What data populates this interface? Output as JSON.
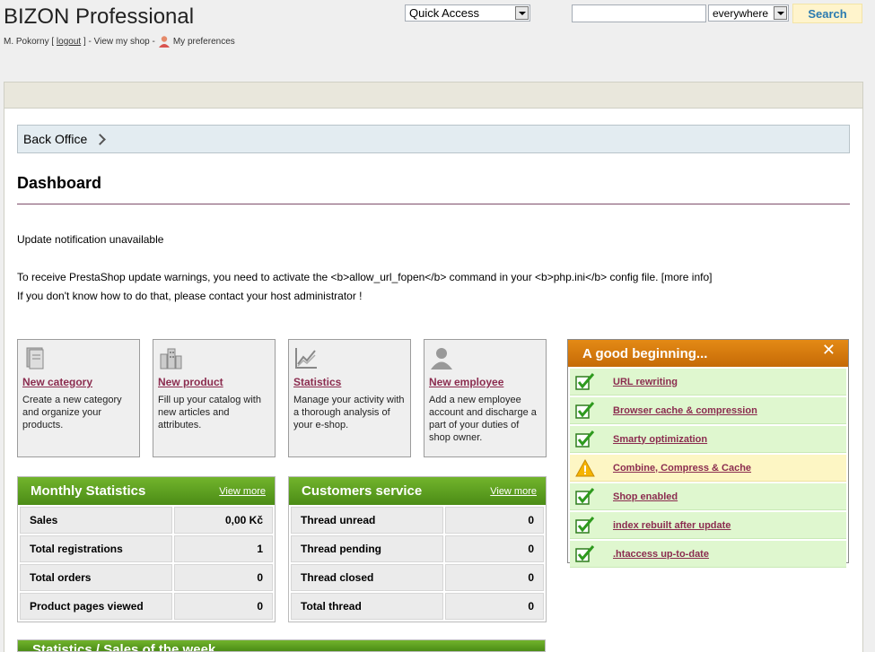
{
  "header": {
    "brand": "BIZON Professional",
    "user_name": "M. Pokorny",
    "logout_open": "[",
    "logout_label": "logout",
    "logout_close": "]",
    "sep1": "-",
    "view_shop_label": "View my shop",
    "sep2": "-",
    "preferences_label": "My preferences",
    "quick_access_value": "Quick Access",
    "search_value": "",
    "search_scope_value": "everywhere",
    "search_button_label": "Search"
  },
  "breadcrumb": {
    "label": "Back Office"
  },
  "page": {
    "title": "Dashboard",
    "update_notice": "Update notification unavailable",
    "warning_line1": "To receive PrestaShop update warnings, you need to activate the <b>allow_url_fopen</b> command in your <b>php.ini</b> config file. [more info]",
    "warning_line2": "If you don't know how to do that, please contact your host administrator !"
  },
  "quick_tiles": [
    {
      "title": "New category",
      "desc": "Create a new category and organize your products.",
      "icon": "catalog-icon"
    },
    {
      "title": "New product",
      "desc": "Fill up your catalog with new articles and attributes.",
      "icon": "product-icon"
    },
    {
      "title": "Statistics",
      "desc": "Manage your activity with a thorough analysis of your e-shop.",
      "icon": "chart-icon"
    },
    {
      "title": "New employee",
      "desc": "Add a new employee account and discharge a part of your duties of shop owner.",
      "icon": "user-icon"
    }
  ],
  "monthly_stats": {
    "title": "Monthly Statistics",
    "view_more": "View more",
    "rows": [
      {
        "label": "Sales",
        "value": "0,00 Kč"
      },
      {
        "label": "Total registrations",
        "value": "1"
      },
      {
        "label": "Total orders",
        "value": "0"
      },
      {
        "label": "Product pages viewed",
        "value": "0"
      }
    ]
  },
  "customer_service": {
    "title": "Customers service",
    "view_more": "View more",
    "rows": [
      {
        "label": "Thread unread",
        "value": "0"
      },
      {
        "label": "Thread pending",
        "value": "0"
      },
      {
        "label": "Thread closed",
        "value": "0"
      },
      {
        "label": "Total thread",
        "value": "0"
      }
    ]
  },
  "bottom_box": {
    "title": "Statistics / Sales of the week"
  },
  "good_beginning": {
    "title": "A good beginning...",
    "close": "✕",
    "items": [
      {
        "label": "URL rewriting",
        "status": "ok"
      },
      {
        "label": "Browser cache & compression",
        "status": "ok"
      },
      {
        "label": "Smarty optimization",
        "status": "ok"
      },
      {
        "label": "Combine, Compress & Cache",
        "status": "warning"
      },
      {
        "label": "Shop enabled",
        "status": "ok"
      },
      {
        "label": "index rebuilt after update",
        "status": "ok"
      },
      {
        "label": ".htaccess up-to-date",
        "status": "ok"
      }
    ]
  },
  "colors": {
    "accent_link": "#8b2c4f",
    "green_header": "#5fa21f",
    "orange_header": "#d67a0e",
    "breadcrumb_bg": "#e3ecf1"
  }
}
